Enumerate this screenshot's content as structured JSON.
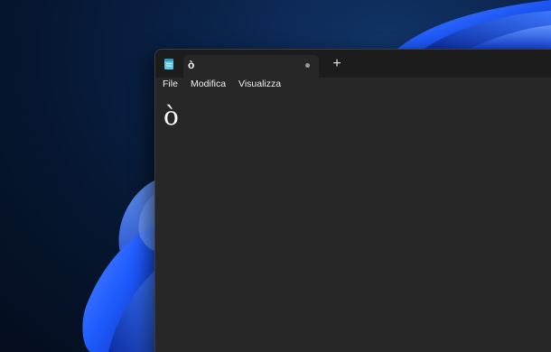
{
  "notepad": {
    "tab": {
      "title": "ò",
      "modified": true
    },
    "new_tab_label": "+",
    "menu": {
      "file": "File",
      "edit": "Modifica",
      "view": "Visualizza"
    },
    "editor": {
      "content": "ò"
    },
    "icons": {
      "app": "notepad-icon",
      "unsaved": "unsaved-dot-icon"
    }
  },
  "colors": {
    "accent_blue": "#1f5cff",
    "editor_background": "#272727",
    "titlebar_background": "#1c1c1c",
    "text": "#ffffff"
  }
}
